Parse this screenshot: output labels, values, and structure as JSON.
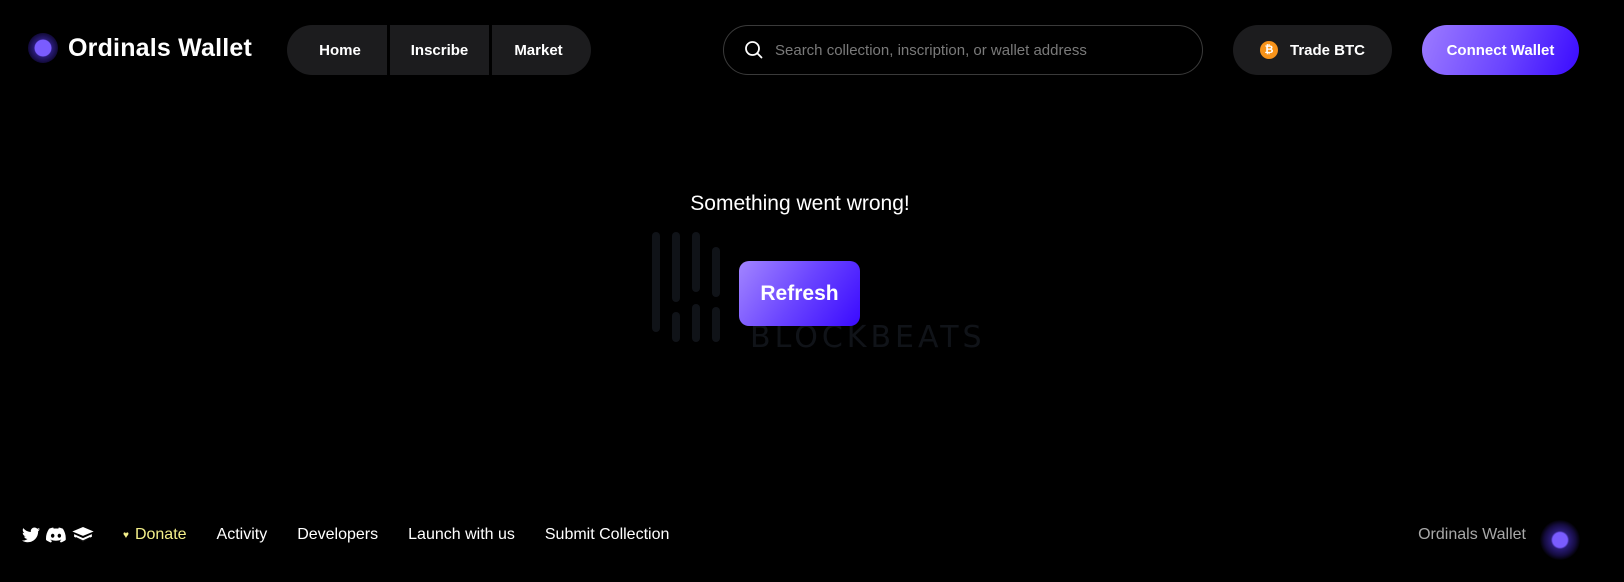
{
  "header": {
    "brand": "Ordinals Wallet",
    "nav": [
      {
        "label": "Home"
      },
      {
        "label": "Inscribe"
      },
      {
        "label": "Market"
      }
    ],
    "search": {
      "placeholder": "Search collection, inscription, or wallet address",
      "value": "",
      "icon": "search-icon"
    },
    "trade_button": {
      "label": "Trade BTC",
      "icon": "bitcoin-icon",
      "icon_glyph": "₿"
    },
    "connect_button": {
      "label": "Connect Wallet"
    }
  },
  "main": {
    "error_message": "Something went wrong!",
    "refresh_label": "Refresh",
    "watermark": "BLOCKBEATS"
  },
  "footer": {
    "social_icons": [
      "twitter-icon",
      "discord-icon",
      "docs-icon"
    ],
    "links": [
      {
        "label": "Donate",
        "icon": "heart-icon",
        "color": "#f4f08a"
      },
      {
        "label": "Activity"
      },
      {
        "label": "Developers"
      },
      {
        "label": "Launch with us"
      },
      {
        "label": "Submit Collection"
      }
    ],
    "brand": "Ordinals Wallet"
  },
  "colors": {
    "background": "#000000",
    "pill": "#1c1c1e",
    "accent_start": "#9c7bff",
    "accent_end": "#3a0aff",
    "bitcoin": "#f7931a",
    "donate": "#f4f08a"
  }
}
